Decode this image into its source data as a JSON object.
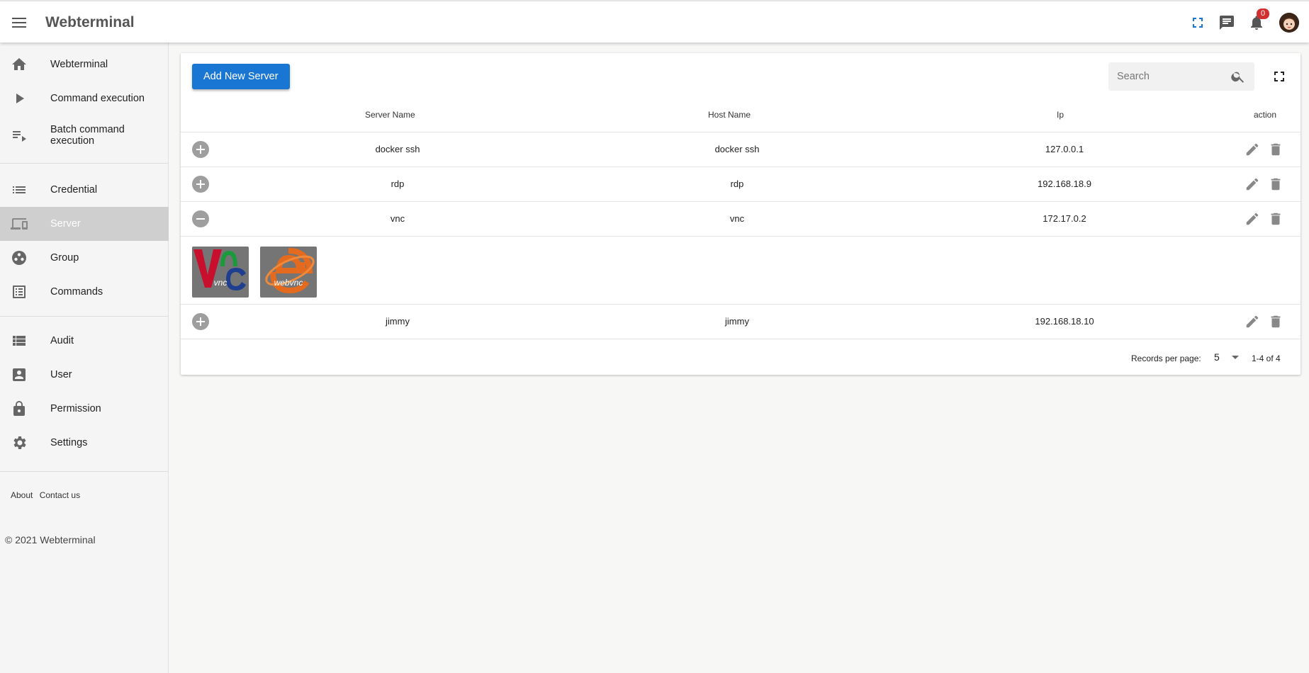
{
  "app": {
    "title": "Webterminal"
  },
  "header": {
    "notification_count": "0"
  },
  "sidebar": {
    "items": [
      {
        "label": "Webterminal",
        "icon": "home-icon"
      },
      {
        "label": "Command execution",
        "icon": "play-icon"
      },
      {
        "label": "Batch command execution",
        "icon": "playlist-icon"
      },
      {
        "label": "Credential",
        "icon": "list-icon"
      },
      {
        "label": "Server",
        "icon": "devices-icon",
        "active": true
      },
      {
        "label": "Group",
        "icon": "group-icon"
      },
      {
        "label": "Commands",
        "icon": "list-box-icon"
      },
      {
        "label": "Audit",
        "icon": "view-list-icon"
      },
      {
        "label": "User",
        "icon": "account-box-icon"
      },
      {
        "label": "Permission",
        "icon": "lock-icon"
      },
      {
        "label": "Settings",
        "icon": "gear-icon"
      }
    ],
    "footer_links": [
      "About",
      "Contact us"
    ],
    "copyright": "© 2021 Webterminal"
  },
  "toolbar": {
    "add_label": "Add New Server",
    "search_placeholder": "Search"
  },
  "table": {
    "columns": [
      "Server Name",
      "Host Name",
      "Ip",
      "action"
    ],
    "rows": [
      {
        "server_name": "docker ssh",
        "host_name": "docker ssh",
        "ip": "127.0.0.1",
        "expanded": false
      },
      {
        "server_name": "rdp",
        "host_name": "rdp",
        "ip": "192.168.18.9",
        "expanded": false
      },
      {
        "server_name": "vnc",
        "host_name": "vnc",
        "ip": "172.17.0.2",
        "expanded": true
      },
      {
        "server_name": "jimmy",
        "host_name": "jimmy",
        "ip": "192.168.18.10",
        "expanded": false
      }
    ],
    "expanded_protocols": [
      "vnc",
      "webvnc"
    ]
  },
  "pagination": {
    "label": "Records per page:",
    "per_page": "5",
    "range": "1-4 of 4"
  },
  "colors": {
    "primary": "#1976d2",
    "badge": "#d32f2f",
    "active_nav_bg": "#cfcfcf",
    "toggle": "#9e9e9e"
  }
}
